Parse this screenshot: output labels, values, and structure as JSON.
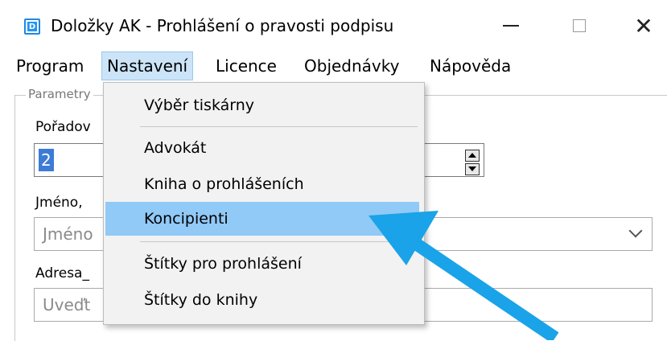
{
  "window": {
    "icon_letter": "D",
    "title": "Doložky AK - Prohlášení o pravosti podpisu",
    "close_glyph": "✕"
  },
  "menu": {
    "items": [
      "Program",
      "Nastavení",
      "Licence",
      "Objednávky",
      "Nápověda"
    ],
    "active": "Nastavení"
  },
  "dropdown": {
    "items": [
      "Výběr tiskárny",
      "Advokát",
      "Kniha o prohlášeních",
      "Koncipienti",
      "Štítky pro prohlášení",
      "Štítky do knihy"
    ],
    "highlighted": "Koncipienti"
  },
  "form": {
    "group_label": "Parametry",
    "poradi_label": "Pořadov",
    "poradi_value": "2",
    "jmeno_label": "Jméno,",
    "jmeno_placeholder": "Jméno",
    "adresa_label": "Adresa_",
    "adresa_placeholder": "Uveďt"
  },
  "annotation": {
    "arrow_color": "#1aa3e8",
    "points_to": "Koncipienti"
  },
  "colors": {
    "menu_active_bg": "#cce4f7",
    "dropdown_highlight": "#91c9f7",
    "selection": "#3d7bd6"
  }
}
